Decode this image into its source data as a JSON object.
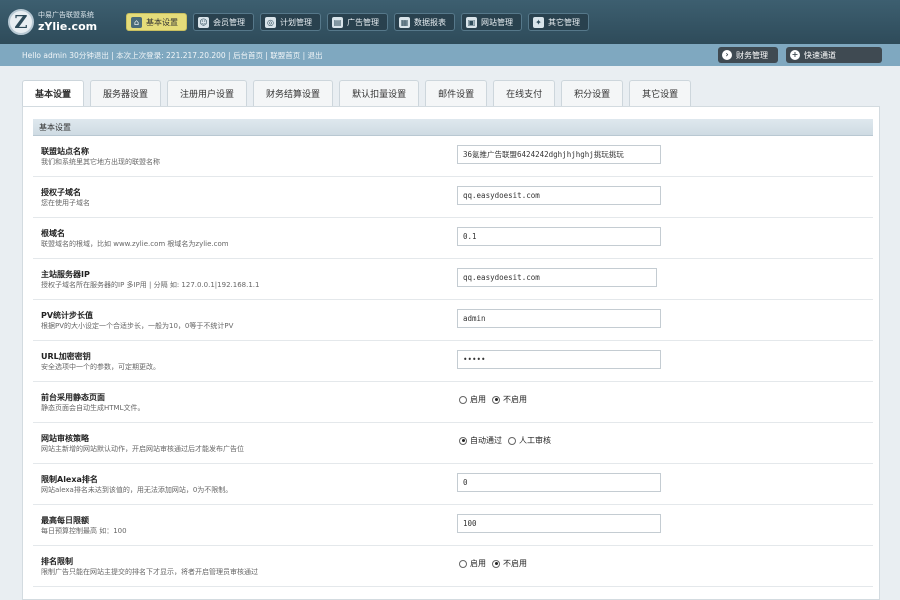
{
  "header": {
    "logo_line1": "中易广告联盟系统",
    "logo_line2": "zYlie.com",
    "logo_glyph": "Z",
    "nav": [
      {
        "label": "基本设置",
        "icon": "home-icon",
        "glyph": "⌂",
        "active": true
      },
      {
        "label": "会员管理",
        "icon": "users-icon",
        "glyph": "☺",
        "active": false
      },
      {
        "label": "计划管理",
        "icon": "plan-icon",
        "glyph": "◎",
        "active": false
      },
      {
        "label": "广告管理",
        "icon": "ads-icon",
        "glyph": "▤",
        "active": false
      },
      {
        "label": "数据报表",
        "icon": "report-icon",
        "glyph": "▦",
        "active": false
      },
      {
        "label": "网站管理",
        "icon": "site-icon",
        "glyph": "▣",
        "active": false
      },
      {
        "label": "其它管理",
        "icon": "other-icon",
        "glyph": "✦",
        "active": false
      }
    ]
  },
  "infobar": {
    "text": "Hello admin 30分钟退出 | 本次上次登录: 221.217.20.200 | 后台首页 | 联盟首页 | 退出",
    "finance_label": "财务管理",
    "quick_label": "快速通道"
  },
  "tabs": [
    {
      "label": "基本设置",
      "active": true
    },
    {
      "label": "服务器设置",
      "active": false
    },
    {
      "label": "注册用户设置",
      "active": false
    },
    {
      "label": "财务结算设置",
      "active": false
    },
    {
      "label": "默认扣量设置",
      "active": false
    },
    {
      "label": "邮件设置",
      "active": false
    },
    {
      "label": "在线支付",
      "active": false
    },
    {
      "label": "积分设置",
      "active": false
    },
    {
      "label": "其它设置",
      "active": false
    }
  ],
  "section_title": "基本设置",
  "rows": [
    {
      "label": "联盟站点名称",
      "desc": "我们和系统里其它地方出现的联盟名称",
      "type": "input",
      "value": "36氪推广告联盟6424242dghjhjhghj挑玩挑玩",
      "width": 204
    },
    {
      "label": "授权子域名",
      "desc": "您在使用子域名",
      "type": "input",
      "value": "qq.easydoesit.com",
      "width": 204
    },
    {
      "label": "根域名",
      "desc": "联盟域名的根域，比如 www.zylie.com 根域名为zylie.com",
      "type": "input",
      "value": "0.1",
      "width": 204
    },
    {
      "label": "主站服务器IP",
      "desc": "授权子域名所在服务器的IP 多IP用 | 分隔 如: 127.0.0.1|192.168.1.1",
      "type": "input",
      "value": "qq.easydoesit.com",
      "width": 200
    },
    {
      "label": "PV统计步长值",
      "desc": "根据PV的大小设定一个合适步长，一般为10，0等于不统计PV",
      "type": "input",
      "value": "admin",
      "width": 204
    },
    {
      "label": "URL加密密钥",
      "desc": "安全选项中一个的参数，可定期更改。",
      "type": "input",
      "value": "•••••",
      "width": 204
    },
    {
      "label": "前台采用静态页面",
      "desc": "静态页面会自动生成HTML文件。",
      "type": "radio",
      "options": [
        {
          "label": "启用",
          "on": false
        },
        {
          "label": "不启用",
          "on": true
        }
      ]
    },
    {
      "label": "网站审核策略",
      "desc": "网站主新增的网站默认动作，开启网站审核通过后才能发布广告位",
      "type": "radio",
      "options": [
        {
          "label": "自动通过",
          "on": true
        },
        {
          "label": "人工审核",
          "on": false
        }
      ]
    },
    {
      "label": "限制Alexa排名",
      "desc": "网站alexa排名未达到该值的，用无法添加网站，0为不限制。",
      "type": "input",
      "value": "0",
      "width": 204
    },
    {
      "label": "最高每日限额",
      "desc": "每日预算控制最高 如：100",
      "type": "input",
      "value": "100",
      "width": 204
    },
    {
      "label": "排名限制",
      "desc": "限制广告只能在网站主提交的排名下才显示，将者开启管理员审核通过",
      "type": "radio",
      "options": [
        {
          "label": "启用",
          "on": false
        },
        {
          "label": "不启用",
          "on": true
        }
      ]
    }
  ],
  "colors": {
    "header": "#2e4b5a",
    "infobar": "#7fa8c0",
    "active_nav": "#e5dc7a"
  }
}
